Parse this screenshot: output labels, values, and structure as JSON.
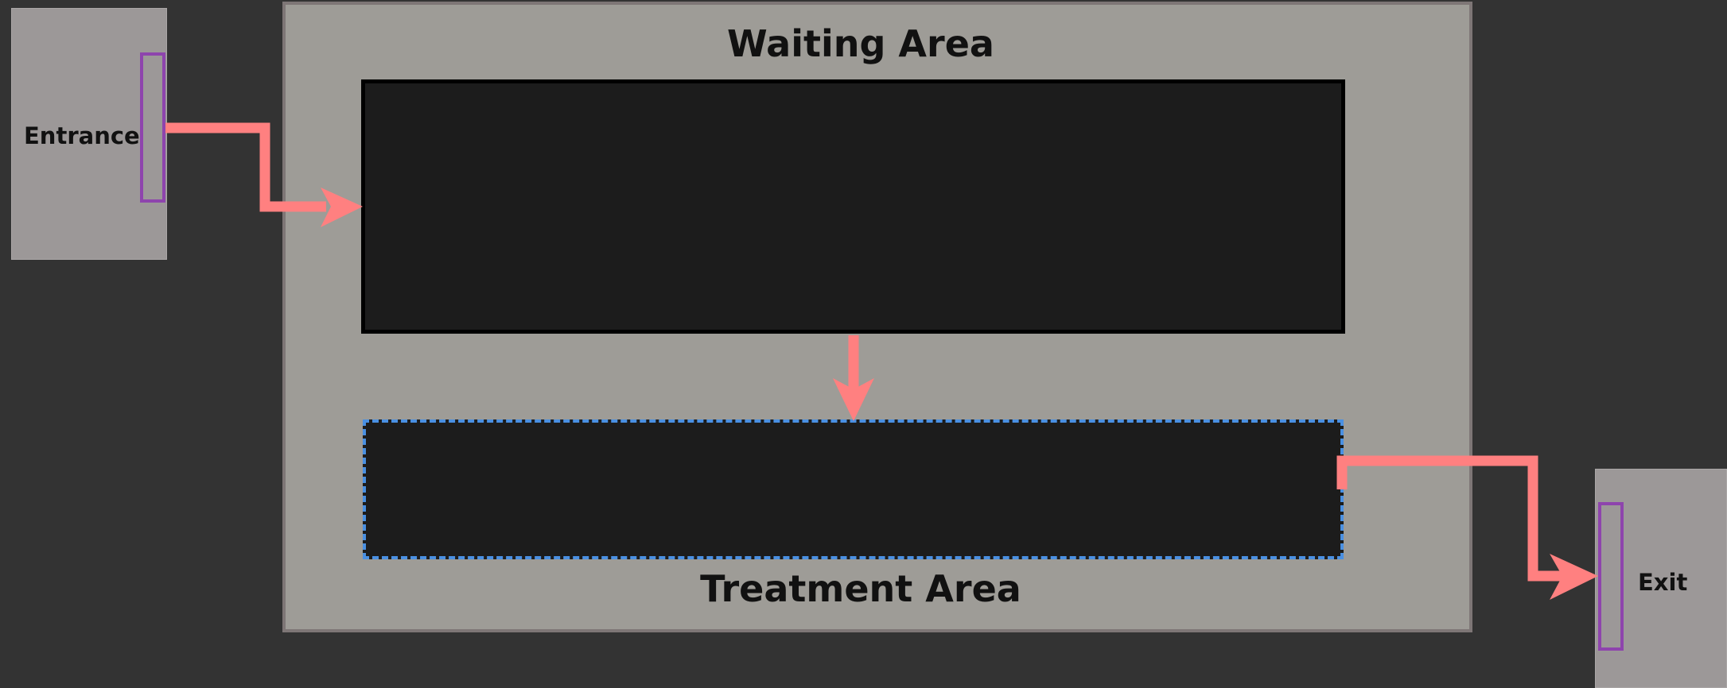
{
  "rooms": {
    "entrance": {
      "label": "Entrance"
    },
    "exit": {
      "label": "Exit"
    }
  },
  "areas": {
    "waiting": {
      "title": "Waiting Area"
    },
    "treatment": {
      "title": "Treatment Area"
    }
  },
  "colors": {
    "background": "#333333",
    "room_fill": "#9c9898",
    "main_room_fill": "#9e9c97",
    "area_fill": "#1c1c1c",
    "door_outline": "#8e44ad",
    "flow_arrow": "#ff8080",
    "treatment_dash": "#4a90e2"
  },
  "icons": {
    "flow": "arrow-icon",
    "door": "door-icon"
  }
}
